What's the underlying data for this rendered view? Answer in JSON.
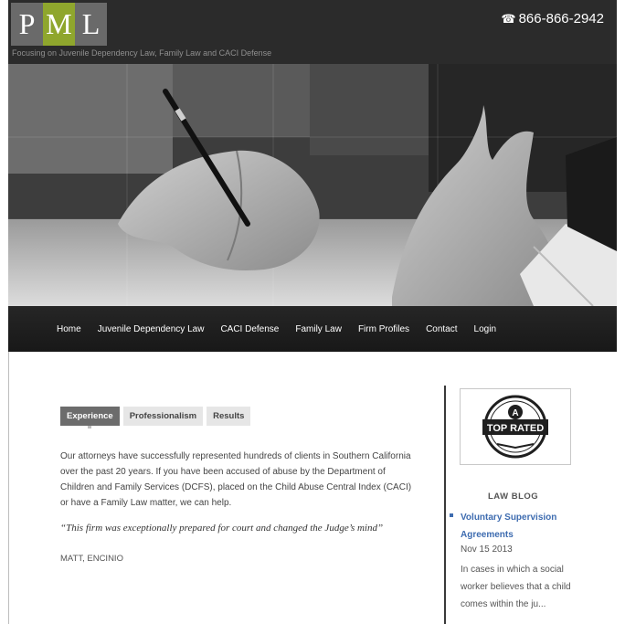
{
  "header": {
    "logo_letters": [
      "P",
      "M",
      "L"
    ],
    "tagline": "Focusing on Juvenile Dependency Law, Family Law and CACI Defense",
    "phone": "866-866-2942",
    "phone_icon": "phone-icon"
  },
  "nav": {
    "items": [
      "Home",
      "Juvenile Dependency Law",
      "CACI Defense",
      "Family Law",
      "Firm Profiles",
      "Contact",
      "Login"
    ]
  },
  "tabs": {
    "items": [
      "Experience",
      "Professionalism",
      "Results"
    ],
    "active": "Experience"
  },
  "main": {
    "body": "Our attorneys have successfully represented hundreds of clients in Southern California over the past 20 years.  If you have been accused of abuse by the Department of Children and Family Services (DCFS), placed on the Child Abuse Central Index (CACI) or have a Family Law matter, we can help.",
    "quote": "“This firm was exceptionally prepared for court and changed the Judge’s mind”",
    "author": "MATT,  ENCINIO"
  },
  "sidebar": {
    "badge_text": "TOP RATED",
    "badge_letter": "A",
    "blog_title": "LAW BLOG",
    "post": {
      "title": "Voluntary Supervision Agreements",
      "date": "Nov 15 2013",
      "excerpt": "In cases in which a social worker believes that a child comes within the ju..."
    }
  },
  "colors": {
    "accent_green": "#8fa62d",
    "link_blue": "#3e6cb0",
    "header_bg": "#2b2b2b"
  }
}
